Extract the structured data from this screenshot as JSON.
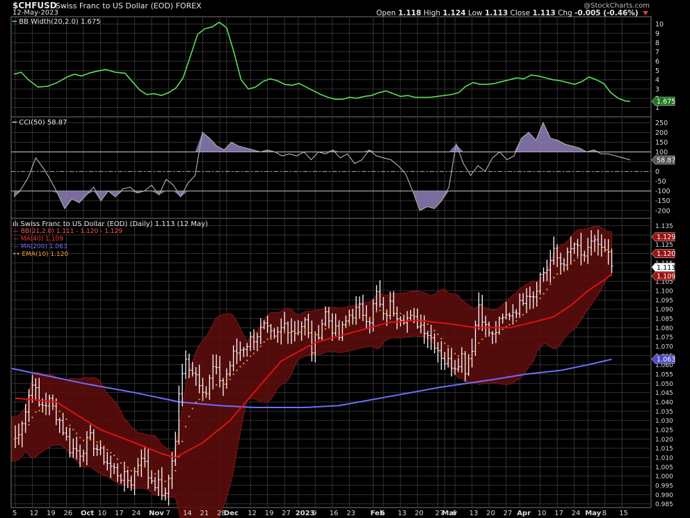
{
  "header": {
    "symbol": "$CHFUSD",
    "title": "Swiss Franc to US Dollar (EOD) FOREX",
    "date": "12-May-2023",
    "brand": "@StockCharts.com",
    "open_label": "Open",
    "open": "1.118",
    "high_label": "High",
    "high": "1.124",
    "low_label": "Low",
    "low": "1.113",
    "close_label": "Close",
    "close": "1.113",
    "chg_label": "Chg",
    "chg": "-0.005 (-0.46%)"
  },
  "panels": {
    "bbwidth_title": "BB Width(20,2.0) 1.675",
    "cci_title": "CCI(50) 58.87",
    "price_title": "Swiss Franc to US Dollar (EOD) (Daily) 1.113 (12 May)",
    "legend": [
      {
        "text": "BB(21,2.0) 1.111 - 1.120 - 1.129",
        "color": "#ff5555"
      },
      {
        "text": "MA(40) 1.109",
        "color": "#ff3333"
      },
      {
        "text": "MA(200) 1.063",
        "color": "#6f6fff"
      },
      {
        "text": "EMA(10) 1.120",
        "color": "#f0a040"
      }
    ]
  },
  "colors": {
    "bbwidth": "#5ce05c",
    "cci_line": "#aaaaaa",
    "cci_fill": "#8f7fb8",
    "bb_fill": "#5a0d0d",
    "ma40": "#e01010",
    "ma200": "#6f6fff",
    "ema10": "#e8a040",
    "bars": "#ffffff"
  },
  "chart_data": [
    {
      "type": "line",
      "name": "BB Width(20,2.0)",
      "ylim": [
        0,
        10.8
      ],
      "yticks": [
        "1",
        "2",
        "3",
        "4",
        "5",
        "6",
        "7",
        "8",
        "9",
        "10"
      ],
      "x": [
        0,
        3,
        6,
        10,
        14,
        18,
        22,
        25,
        28,
        31,
        34,
        38,
        42,
        46,
        49,
        52,
        55,
        58,
        61,
        64,
        67,
        70,
        73,
        76,
        79,
        82,
        85,
        88,
        91,
        94,
        97,
        100,
        103,
        106,
        109,
        112,
        115,
        118,
        121,
        124,
        127,
        130,
        133,
        136,
        139,
        142,
        145,
        148,
        151,
        154,
        157,
        160,
        163,
        166,
        169,
        172,
        175,
        178,
        181,
        184,
        187,
        190,
        193,
        196,
        199,
        202,
        205,
        208,
        211,
        214,
        217,
        220,
        223,
        226,
        229,
        232,
        235,
        238,
        241,
        244,
        247,
        250,
        253,
        255
      ],
      "values": [
        4.6,
        4.8,
        4.0,
        3.2,
        3.3,
        3.7,
        4.3,
        4.6,
        4.4,
        4.7,
        4.9,
        5.1,
        4.8,
        4.7,
        3.8,
        2.9,
        2.4,
        2.5,
        2.3,
        2.6,
        3.1,
        4.2,
        6.5,
        8.9,
        9.5,
        9.7,
        10.2,
        9.6,
        7.0,
        4.0,
        3.0,
        3.2,
        3.8,
        4.1,
        3.9,
        3.5,
        3.4,
        3.6,
        3.2,
        2.8,
        2.4,
        2.1,
        1.9,
        1.9,
        2.1,
        2.0,
        2.2,
        2.3,
        2.6,
        2.8,
        2.5,
        2.2,
        2.3,
        2.1,
        2.1,
        2.1,
        2.2,
        2.3,
        2.4,
        2.6,
        3.3,
        3.7,
        3.5,
        3.5,
        3.6,
        3.8,
        4.0,
        4.2,
        4.1,
        4.5,
        4.4,
        4.2,
        4.0,
        3.9,
        3.7,
        3.5,
        3.8,
        4.3,
        4.0,
        3.6,
        2.6,
        2.0,
        1.7,
        1.675
      ]
    },
    {
      "type": "area",
      "name": "CCI(50)",
      "ylim": [
        -240,
        280
      ],
      "yticks": [
        "250",
        "200",
        "150",
        "100",
        "50",
        "0",
        "-50",
        "-100",
        "-150",
        "-200"
      ],
      "x": [
        0,
        3,
        6,
        9,
        12,
        15,
        18,
        21,
        24,
        27,
        30,
        33,
        36,
        39,
        42,
        45,
        48,
        51,
        54,
        57,
        60,
        63,
        66,
        69,
        72,
        75,
        78,
        81,
        84,
        87,
        90,
        93,
        96,
        99,
        102,
        105,
        108,
        111,
        114,
        117,
        120,
        123,
        126,
        129,
        132,
        135,
        138,
        141,
        144,
        147,
        150,
        153,
        156,
        159,
        162,
        165,
        168,
        171,
        174,
        177,
        180,
        183,
        186,
        189,
        192,
        195,
        198,
        201,
        204,
        207,
        210,
        213,
        216,
        219,
        222,
        225,
        228,
        231,
        234,
        237,
        240,
        243,
        246,
        249,
        252,
        255
      ],
      "values": [
        -130,
        -90,
        -30,
        70,
        20,
        -40,
        -110,
        -190,
        -140,
        -160,
        -120,
        -80,
        -150,
        -100,
        -130,
        -90,
        -80,
        -110,
        -100,
        -70,
        -120,
        -40,
        -70,
        -130,
        -60,
        -20,
        200,
        170,
        130,
        110,
        150,
        130,
        120,
        110,
        100,
        110,
        100,
        80,
        90,
        80,
        100,
        60,
        100,
        90,
        110,
        70,
        90,
        40,
        60,
        110,
        80,
        70,
        60,
        30,
        -10,
        -100,
        -200,
        -180,
        -190,
        -150,
        -80,
        140,
        40,
        -20,
        30,
        0,
        70,
        100,
        60,
        80,
        170,
        200,
        160,
        250,
        170,
        160,
        140,
        130,
        120,
        100,
        110,
        90,
        90,
        80,
        70,
        58.87
      ]
    },
    {
      "type": "line",
      "name": "Swiss Franc to US Dollar (EOD) (Daily)",
      "ylim": [
        0.983,
        1.139
      ],
      "yticks": [
        "1.135",
        "1.130",
        "1.125",
        "1.120",
        "1.115",
        "1.110",
        "1.105",
        "1.100",
        "1.095",
        "1.090",
        "1.085",
        "1.080",
        "1.075",
        "1.070",
        "1.065",
        "1.060",
        "1.055",
        "1.050",
        "1.045",
        "1.040",
        "1.035",
        "1.030",
        "1.025",
        "1.020",
        "1.015",
        "1.010",
        "1.005",
        "1.000",
        "0.995",
        "0.990",
        "0.985"
      ],
      "xticks": [
        {
          "day": 0,
          "label": "5"
        },
        {
          "day": 5,
          "label": "12"
        },
        {
          "day": 10,
          "label": "19"
        },
        {
          "day": 15,
          "label": "26"
        },
        {
          "day": 20,
          "label": "Oct"
        },
        {
          "day": 25,
          "label": "10"
        },
        {
          "day": 30,
          "label": "17"
        },
        {
          "day": 35,
          "label": "24"
        },
        {
          "day": 40,
          "label": "Nov"
        },
        {
          "day": 45,
          "label": "7"
        },
        {
          "day": 50,
          "label": "14"
        },
        {
          "day": 55,
          "label": "21"
        },
        {
          "day": 60,
          "label": "28"
        },
        {
          "day": 62,
          "label": "Dec"
        },
        {
          "day": 69,
          "label": "12"
        },
        {
          "day": 74,
          "label": "19"
        },
        {
          "day": 79,
          "label": "27"
        },
        {
          "day": 83,
          "label": "2023"
        },
        {
          "day": 88,
          "label": "9"
        },
        {
          "day": 93,
          "label": "16"
        },
        {
          "day": 98,
          "label": "23"
        },
        {
          "day": 105,
          "label": "Feb"
        },
        {
          "day": 108,
          "label": "6"
        },
        {
          "day": 113,
          "label": "13"
        },
        {
          "day": 118,
          "label": "20"
        },
        {
          "day": 124,
          "label": "27"
        },
        {
          "day": 126,
          "label": "Mar"
        },
        {
          "day": 129,
          "label": "6"
        },
        {
          "day": 134,
          "label": "13"
        },
        {
          "day": 139,
          "label": "20"
        },
        {
          "day": 144,
          "label": "27"
        },
        {
          "day": 148,
          "label": "Apr"
        },
        {
          "day": 154,
          "label": "10"
        },
        {
          "day": 159,
          "label": "17"
        },
        {
          "day": 164,
          "label": "24"
        },
        {
          "day": 168,
          "label": "May"
        },
        {
          "day": 173,
          "label": "8"
        },
        {
          "day": 178,
          "label": "15"
        }
      ],
      "last_day": 175,
      "close_anchors": [
        [
          0,
          1.02
        ],
        [
          3,
          1.035
        ],
        [
          5,
          1.052
        ],
        [
          7,
          1.038
        ],
        [
          10,
          1.04
        ],
        [
          13,
          1.03
        ],
        [
          16,
          1.015
        ],
        [
          19,
          1.013
        ],
        [
          22,
          1.02
        ],
        [
          25,
          1.012
        ],
        [
          28,
          1.005
        ],
        [
          31,
          1.0
        ],
        [
          34,
          0.997
        ],
        [
          37,
          1.012
        ],
        [
          39,
          1.0
        ],
        [
          42,
          0.995
        ],
        [
          44,
          0.988
        ],
        [
          46,
          1.01
        ],
        [
          47,
          1.018
        ],
        [
          48,
          1.045
        ],
        [
          50,
          1.062
        ],
        [
          53,
          1.055
        ],
        [
          56,
          1.045
        ],
        [
          58,
          1.058
        ],
        [
          61,
          1.05
        ],
        [
          64,
          1.065
        ],
        [
          67,
          1.07
        ],
        [
          70,
          1.075
        ],
        [
          73,
          1.08
        ],
        [
          76,
          1.073
        ],
        [
          79,
          1.082
        ],
        [
          82,
          1.078
        ],
        [
          85,
          1.083
        ],
        [
          87,
          1.068
        ],
        [
          89,
          1.078
        ],
        [
          91,
          1.088
        ],
        [
          93,
          1.08
        ],
        [
          95,
          1.075
        ],
        [
          98,
          1.087
        ],
        [
          101,
          1.09
        ],
        [
          104,
          1.085
        ],
        [
          106,
          1.098
        ],
        [
          108,
          1.085
        ],
        [
          110,
          1.092
        ],
        [
          112,
          1.088
        ],
        [
          115,
          1.085
        ],
        [
          118,
          1.083
        ],
        [
          120,
          1.08
        ],
        [
          123,
          1.072
        ],
        [
          126,
          1.062
        ],
        [
          129,
          1.06
        ],
        [
          131,
          1.065
        ],
        [
          132,
          1.058
        ],
        [
          134,
          1.07
        ],
        [
          136,
          1.093
        ],
        [
          138,
          1.08
        ],
        [
          140,
          1.075
        ],
        [
          142,
          1.082
        ],
        [
          145,
          1.088
        ],
        [
          148,
          1.092
        ],
        [
          150,
          1.1
        ],
        [
          152,
          1.098
        ],
        [
          154,
          1.108
        ],
        [
          156,
          1.112
        ],
        [
          158,
          1.12
        ],
        [
          160,
          1.115
        ],
        [
          162,
          1.118
        ],
        [
          164,
          1.125
        ],
        [
          166,
          1.118
        ],
        [
          168,
          1.12
        ],
        [
          170,
          1.128
        ],
        [
          172,
          1.122
        ],
        [
          174,
          1.118
        ],
        [
          175,
          1.113
        ]
      ],
      "ma40_anchors": [
        [
          0,
          1.042
        ],
        [
          12,
          1.04
        ],
        [
          25,
          1.025
        ],
        [
          35,
          1.018
        ],
        [
          43,
          1.012
        ],
        [
          47,
          1.01
        ],
        [
          55,
          1.018
        ],
        [
          63,
          1.03
        ],
        [
          70,
          1.045
        ],
        [
          78,
          1.062
        ],
        [
          88,
          1.072
        ],
        [
          100,
          1.078
        ],
        [
          110,
          1.083
        ],
        [
          118,
          1.084
        ],
        [
          128,
          1.082
        ],
        [
          135,
          1.08
        ],
        [
          145,
          1.08
        ],
        [
          152,
          1.083
        ],
        [
          158,
          1.086
        ],
        [
          163,
          1.092
        ],
        [
          168,
          1.1
        ],
        [
          173,
          1.106
        ],
        [
          175,
          1.109
        ]
      ],
      "ma200_anchors": [
        [
          -1,
          1.058
        ],
        [
          20,
          1.05
        ],
        [
          35,
          1.045
        ],
        [
          48,
          1.04
        ],
        [
          60,
          1.038
        ],
        [
          70,
          1.037
        ],
        [
          85,
          1.037
        ],
        [
          95,
          1.038
        ],
        [
          110,
          1.043
        ],
        [
          125,
          1.048
        ],
        [
          140,
          1.052
        ],
        [
          150,
          1.055
        ],
        [
          160,
          1.057
        ],
        [
          168,
          1.06
        ],
        [
          175,
          1.063
        ]
      ],
      "markers": {
        "close": 1.113,
        "bb_upper": 1.129,
        "bb_mid": 1.12,
        "bb_lower": 1.109,
        "ma200": 1.063,
        "ema10": 1.12
      }
    }
  ]
}
